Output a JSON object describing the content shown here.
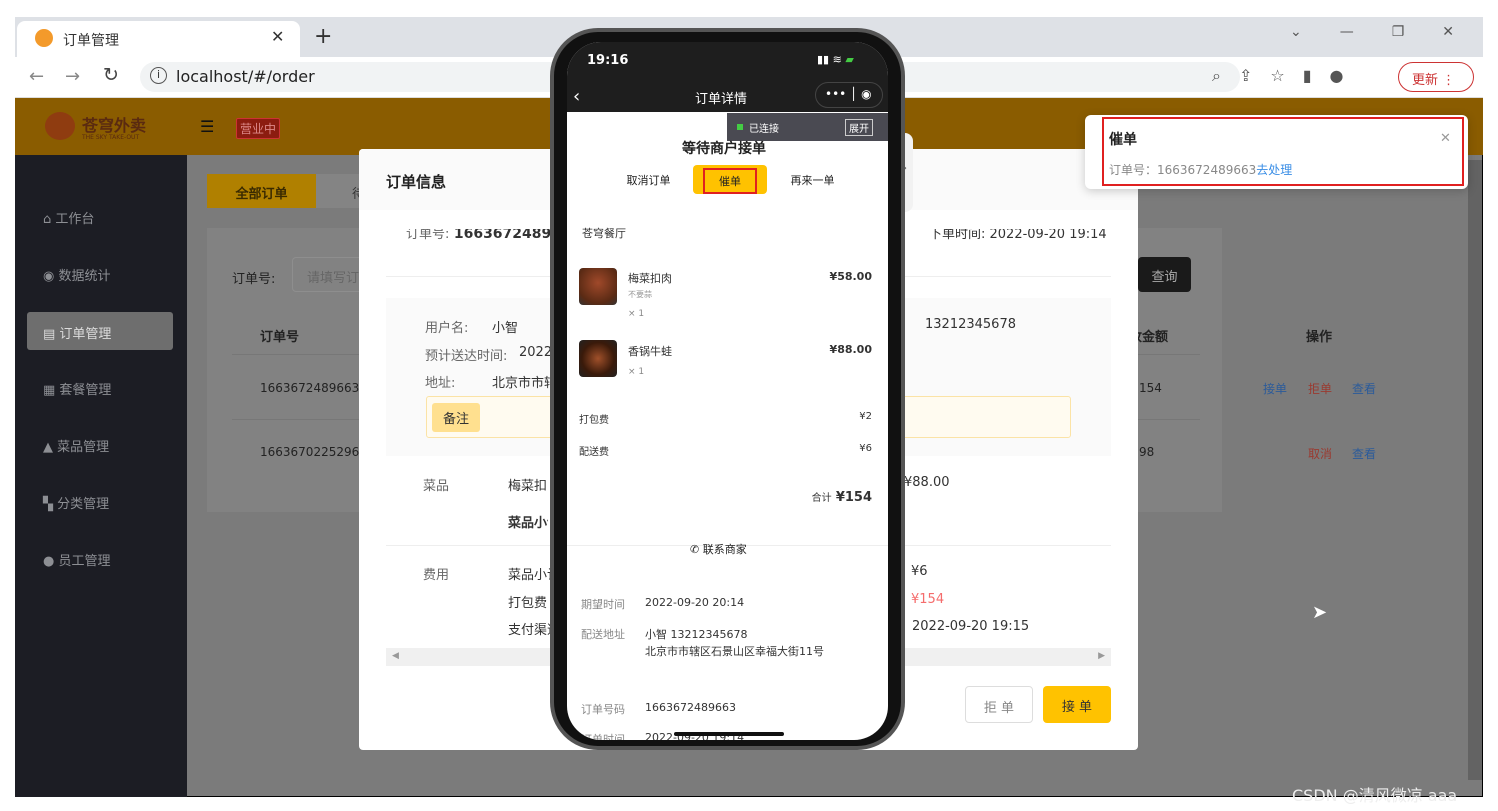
{
  "browser": {
    "tab_title": "订单管理",
    "url": "localhost/#/order",
    "update_label": "更新"
  },
  "app": {
    "logo_text": "苍穹外卖",
    "logo_sub": "THE SKY TAKE-OUT",
    "status_badge": "营业中",
    "brand_color": "#ffc200"
  },
  "sidebar": {
    "items": [
      {
        "label": "工作台",
        "icon": "home-icon"
      },
      {
        "label": "数据统计",
        "icon": "chart-icon"
      },
      {
        "label": "订单管理",
        "icon": "clipboard-icon",
        "active": true
      },
      {
        "label": "套餐管理",
        "icon": "gift-icon"
      },
      {
        "label": "菜品管理",
        "icon": "dish-icon"
      },
      {
        "label": "分类管理",
        "icon": "grid-icon"
      },
      {
        "label": "员工管理",
        "icon": "info-icon"
      }
    ]
  },
  "main": {
    "tabs": [
      {
        "label": "全部订单"
      },
      {
        "label": "待"
      }
    ],
    "search_label": "订单号:",
    "search_placeholder": "请填写订",
    "query_button": "查询",
    "table": {
      "headers": [
        "订单号",
        "实收金额",
        "操作"
      ],
      "rows": [
        {
          "id": "1663672489663",
          "amount": "154",
          "actions": [
            "接单",
            "拒单",
            "查看"
          ]
        },
        {
          "id": "1663670225296",
          "amount": "98",
          "actions": [
            "取消",
            "查看"
          ]
        }
      ]
    }
  },
  "dialog": {
    "title": "订单信息",
    "order_no_label": "订单号:",
    "order_no": "1663672489663",
    "order_time": "下单时间: 2022-09-20 19:14",
    "user_label": "用户名:",
    "user": "小智",
    "phone": "13212345678",
    "eta_label": "预计送达时间:",
    "eta": "2022-",
    "addr_label": "地址:",
    "addr": "北京市市辖",
    "remark_label": "备注",
    "dish_label": "菜品",
    "dish_name": "梅菜扣",
    "dish_price": "¥88.00",
    "subtotal_label": "菜品小计",
    "fee_label": "费用",
    "fee_rows": [
      {
        "label": "菜品小计",
        "value": "¥6"
      },
      {
        "label": "打包费",
        "value": "¥154"
      },
      {
        "label": "支付渠道",
        "value": "2022-09-20 19:15"
      }
    ],
    "reject_button": "拒 单",
    "accept_button": "接 单"
  },
  "phone": {
    "time": "19:16",
    "nav_title": "订单详情",
    "debug_status": "已连接",
    "debug_expand": "展开",
    "status": "等待商户接单",
    "actions": [
      "取消订单",
      "催单",
      "再来一单"
    ],
    "shop": "苍穹餐厅",
    "dishes": [
      {
        "name": "梅菜扣肉",
        "note": "不要蒜",
        "qty": "× 1",
        "price": "¥58.00"
      },
      {
        "name": "香锅牛蛙",
        "note": "",
        "qty": "× 1",
        "price": "¥88.00"
      }
    ],
    "pack_fee_label": "打包费",
    "pack_fee": "¥2",
    "delivery_fee_label": "配送费",
    "delivery_fee": "¥6",
    "total_label": "合计",
    "total": "¥154",
    "contact": "联系商家",
    "info": [
      {
        "label": "期望时间",
        "value": "2022-09-20 20:14"
      },
      {
        "label": "配送地址",
        "value": "小智 13212345678",
        "value2": "北京市市辖区石景山区幸福大街11号"
      },
      {
        "label": "订单号码",
        "value": "1663672489663"
      },
      {
        "label": "订单时间",
        "value": "2022-09-20 19:14"
      }
    ]
  },
  "notification": {
    "title": "催单",
    "text": "订单号：1663672489663",
    "link": "去处理"
  },
  "watermark": "CSDN @清风微凉 aaa"
}
